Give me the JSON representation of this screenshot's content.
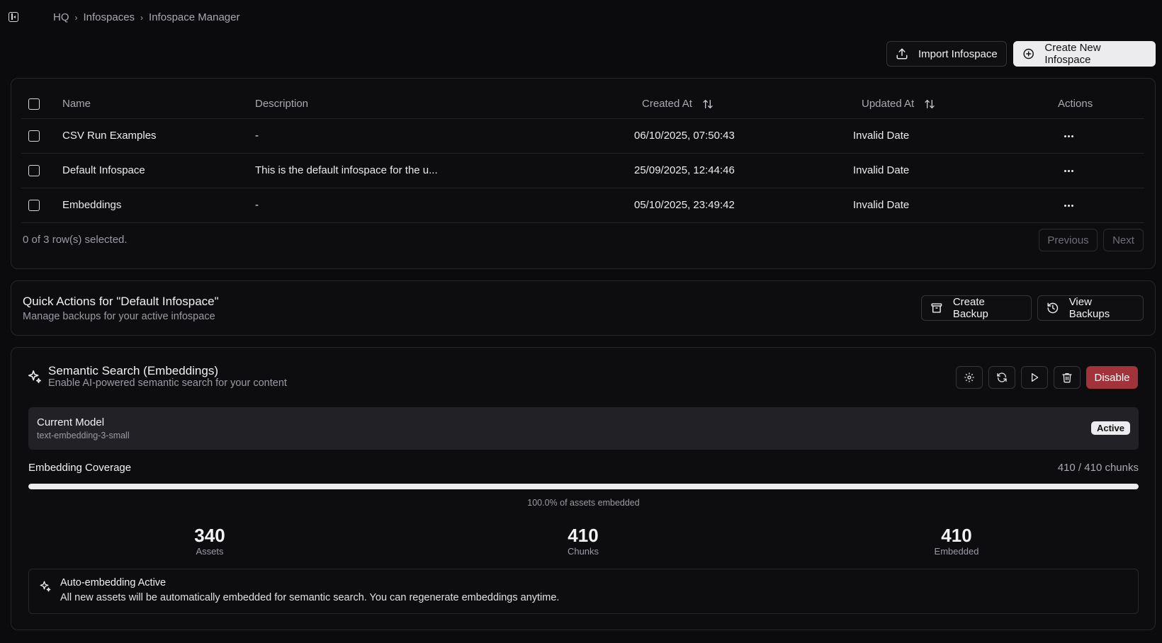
{
  "breadcrumb": {
    "items": [
      "HQ",
      "Infospaces",
      "Infospace Manager"
    ]
  },
  "header_actions": {
    "import_label": "Import Infospace",
    "create_label": "Create New Infospace"
  },
  "table": {
    "columns": {
      "name": "Name",
      "description": "Description",
      "created": "Created At",
      "updated": "Updated At",
      "actions": "Actions"
    },
    "rows": [
      {
        "name": "CSV Run Examples",
        "description": "-",
        "created": "06/10/2025, 07:50:43",
        "updated": "Invalid Date"
      },
      {
        "name": "Default Infospace",
        "description": "This is the default infospace for the u...",
        "created": "25/09/2025, 12:44:46",
        "updated": "Invalid Date"
      },
      {
        "name": "Embeddings",
        "description": "-",
        "created": "05/10/2025, 23:49:42",
        "updated": "Invalid Date"
      }
    ],
    "selection_status": "0 of 3 row(s) selected.",
    "prev_label": "Previous",
    "next_label": "Next"
  },
  "quick_actions": {
    "title": "Quick Actions for \"Default Infospace\"",
    "subtitle": "Manage backups for your active infospace",
    "create_backup_label": "Create Backup",
    "view_backups_label": "View Backups"
  },
  "semantic": {
    "title": "Semantic Search (Embeddings)",
    "subtitle": "Enable AI-powered semantic search for your content",
    "disable_label": "Disable",
    "disable_color": "#a1343a",
    "model_heading": "Current Model",
    "model_name": "text-embedding-3-small",
    "status_badge": "Active",
    "coverage_label": "Embedding Coverage",
    "coverage_count": "410 / 410 chunks",
    "coverage_fraction": 1.0,
    "coverage_caption": "100.0% of assets embedded",
    "stats": [
      {
        "value": "340",
        "label": "Assets"
      },
      {
        "value": "410",
        "label": "Chunks"
      },
      {
        "value": "410",
        "label": "Embedded"
      }
    ],
    "auto_title": "Auto-embedding Active",
    "auto_text": "All new assets will be automatically embedded for semantic search. You can regenerate embeddings anytime."
  }
}
